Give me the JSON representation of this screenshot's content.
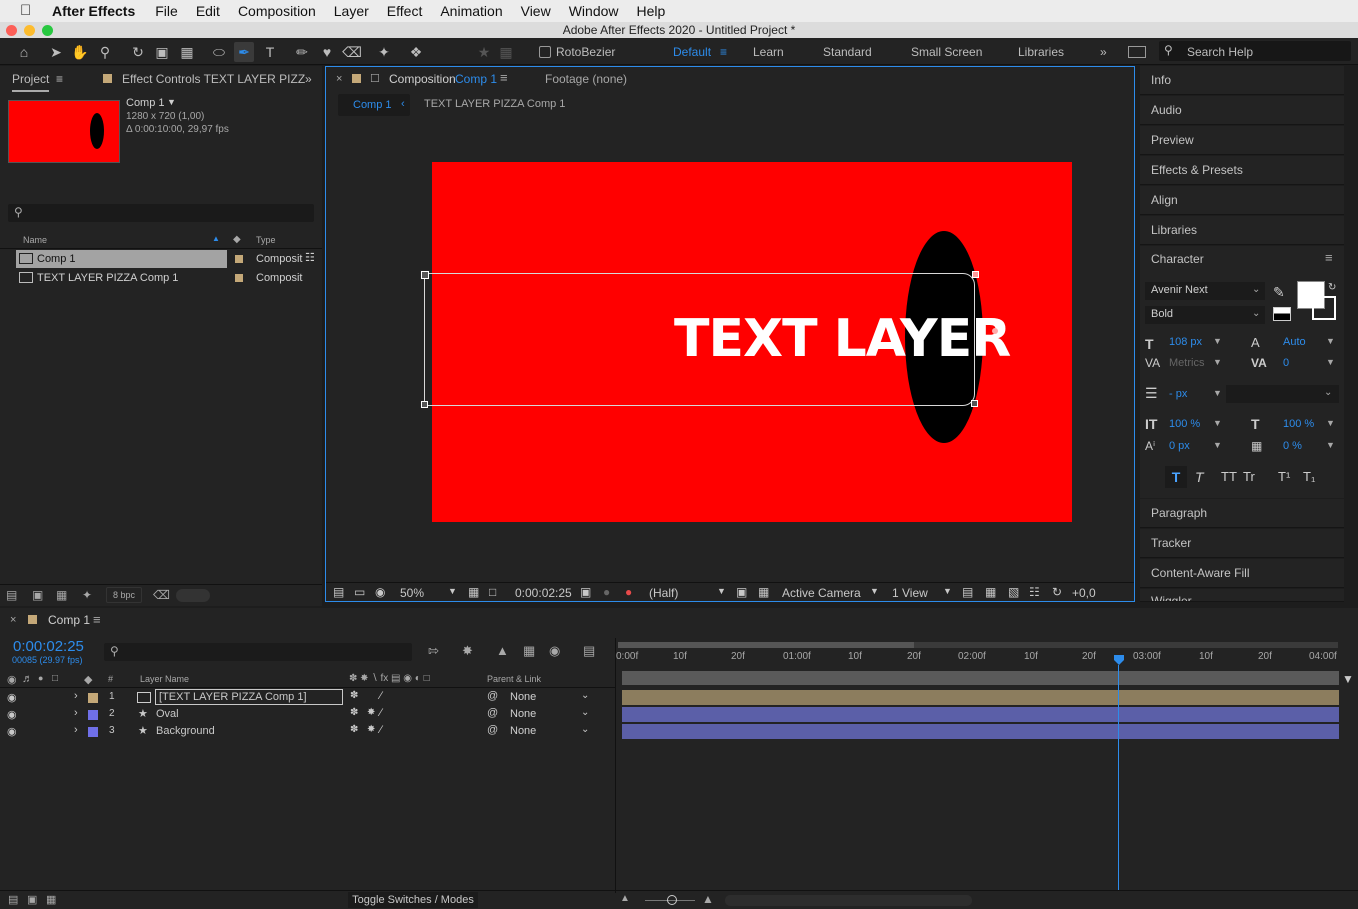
{
  "menubar": {
    "app_name": "After Effects",
    "items": [
      "File",
      "Edit",
      "Composition",
      "Layer",
      "Effect",
      "Animation",
      "View",
      "Window",
      "Help"
    ]
  },
  "titlebar": {
    "title": "Adobe After Effects 2020 - Untitled Project *"
  },
  "toolbar": {
    "rotobezier_label": "RotoBezier",
    "workspaces": [
      "Default",
      "Learn",
      "Standard",
      "Small Screen",
      "Libraries"
    ],
    "search_placeholder": "Search Help"
  },
  "project_panel": {
    "tab_project": "Project",
    "tab_effect_controls": "Effect Controls TEXT LAYER PIZZ",
    "selected_name": "Comp 1",
    "selected_dims": "1280 x 720 (1,00)",
    "selected_duration": "Δ 0:00:10:00, 29,97 fps",
    "col_name": "Name",
    "col_type": "Type",
    "items": [
      {
        "name": "Comp 1",
        "type": "Composit"
      },
      {
        "name": "TEXT LAYER PIZZA Comp 1",
        "type": "Composit"
      }
    ],
    "bpc": "8 bpc"
  },
  "comp_panel": {
    "tab_prefix": "Composition",
    "tab_name": "Comp 1",
    "tab_footage": "Footage (none)",
    "breadcrumb_comp": "Comp 1",
    "breadcrumb_nested": "TEXT LAYER PIZZA Comp 1",
    "canvas_text": "TEXT LAYER",
    "canvas_color": "#ff0000",
    "oval_color": "#000000",
    "zoom": "50%",
    "timecode": "0:00:02:25",
    "resolution": "(Half)",
    "camera": "Active Camera",
    "views": "1 View",
    "exposure": "+0,0"
  },
  "right_panel": {
    "items_top": [
      "Info",
      "Audio",
      "Preview",
      "Effects & Presets",
      "Align",
      "Libraries"
    ],
    "character": {
      "title": "Character",
      "font": "Avenir Next",
      "style": "Bold",
      "size": "108 px",
      "leading": "Auto",
      "kerning": "Metrics",
      "tracking": "0",
      "stroke": "- px",
      "vscale": "100 %",
      "hscale": "100 %",
      "baseline": "0 px",
      "tsume": "0 %",
      "style_buttons": [
        "T",
        "T",
        "TT",
        "Tr",
        "T¹",
        "T₁"
      ]
    },
    "items_bottom": [
      "Paragraph",
      "Tracker",
      "Content-Aware Fill",
      "Wiggler"
    ]
  },
  "timeline": {
    "tab_name": "Comp 1",
    "timecode": "0:00:02:25",
    "frame_info": "00085 (29.97 fps)",
    "col_layer_name": "Layer Name",
    "col_parent": "Parent & Link",
    "ruler_labels": [
      "0:00f",
      "10f",
      "20f",
      "01:00f",
      "10f",
      "20f",
      "02:00f",
      "10f",
      "20f",
      "03:00f",
      "10f",
      "20f",
      "04:00f"
    ],
    "layers": [
      {
        "num": "1",
        "name": "[TEXT LAYER PIZZA Comp 1]",
        "parent": "None",
        "label_color": "#c4a878",
        "bar_color": "#8c7d5e"
      },
      {
        "num": "2",
        "name": "Oval",
        "parent": "None",
        "label_color": "#6f6fe8",
        "bar_color": "#5b5fa8"
      },
      {
        "num": "3",
        "name": "Background",
        "parent": "None",
        "label_color": "#6f6fe8",
        "bar_color": "#5b5fa8"
      }
    ],
    "footer_label": "Toggle Switches / Modes"
  }
}
